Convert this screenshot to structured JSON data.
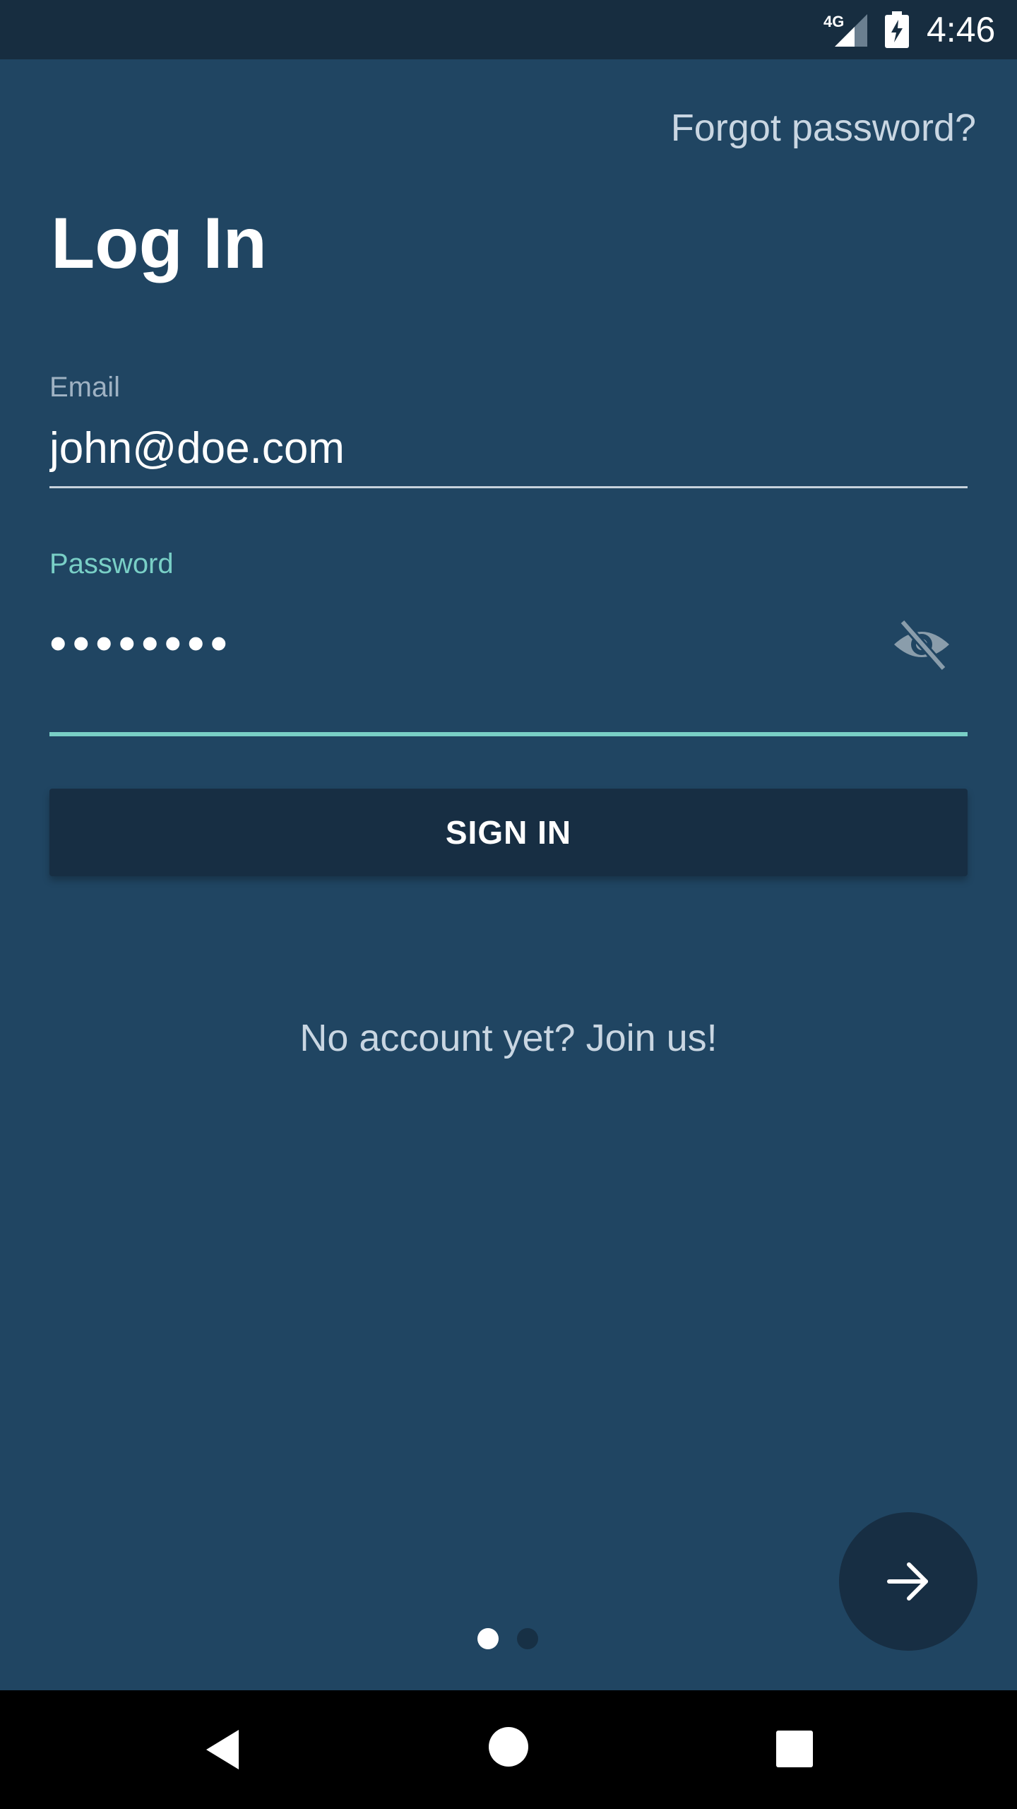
{
  "status_bar": {
    "network_label": "4G",
    "time": "4:46",
    "icons": [
      "signal-icon",
      "battery-charging-icon"
    ]
  },
  "header": {
    "forgot_password": "Forgot password?",
    "title": "Log In"
  },
  "form": {
    "email": {
      "label": "Email",
      "value": "john@doe.com"
    },
    "password": {
      "label": "Password",
      "value": "••••••••",
      "toggle_icon": "eye-off-icon"
    },
    "sign_in_label": "SIGN IN"
  },
  "join_link": "No account yet? Join us!",
  "fab_icon": "arrow-right-icon",
  "pager": {
    "page_count": 2,
    "current_page": 1
  },
  "nav_bar": {
    "icons": [
      "back-icon",
      "home-icon",
      "recents-icon"
    ]
  },
  "colors": {
    "background": "#204562",
    "status_bar": "#172d40",
    "button": "#172e43",
    "accent": "#79cfc6",
    "text_secondary": "#c9d6e2"
  }
}
